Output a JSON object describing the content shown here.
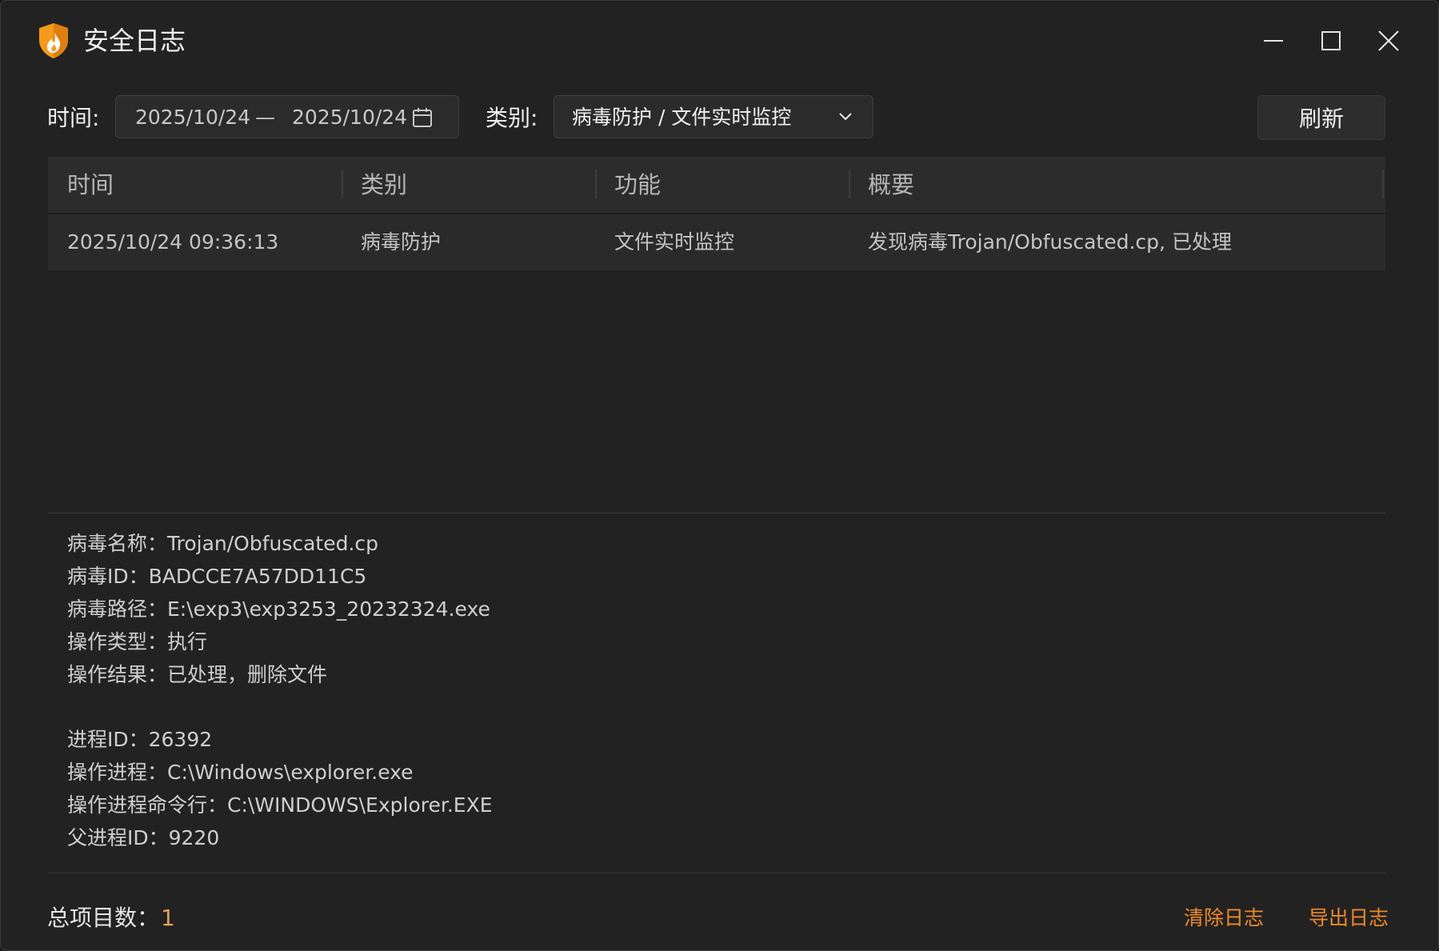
{
  "window": {
    "title": "安全日志"
  },
  "filters": {
    "time_label": "时间:",
    "date_start": "2025/10/24",
    "date_separator": "—",
    "date_end": "2025/10/24",
    "category_label": "类别:",
    "category_value": "病毒防护 / 文件实时监控",
    "refresh_label": "刷新"
  },
  "table": {
    "columns": [
      "时间",
      "类别",
      "功能",
      "概要"
    ],
    "rows": [
      [
        "2025/10/24 09:36:13",
        "病毒防护",
        "文件实时监控",
        "发现病毒Trojan/Obfuscated.cp, 已处理"
      ]
    ]
  },
  "detail": {
    "lines_a": [
      "病毒名称：Trojan/Obfuscated.cp",
      "病毒ID：BADCCE7A57DD11C5",
      "病毒路径：E:\\exp3\\exp3253_20232324.exe",
      "操作类型：执行",
      "操作结果：已处理，删除文件"
    ],
    "lines_b": [
      "进程ID：26392",
      "操作进程：C:\\Windows\\explorer.exe",
      "操作进程命令行：C:\\WINDOWS\\Explorer.EXE",
      "父进程ID：9220"
    ]
  },
  "footer": {
    "total_label": "总项目数：",
    "total_value": "1",
    "clear_label": "清除日志",
    "export_label": "导出日志"
  },
  "colors": {
    "background": "#222222",
    "accent_link": "#ef8a2a",
    "logo_orange": "#f59a1b"
  },
  "icons": [
    "app-shield-flame-icon",
    "minimize-icon",
    "maximize-icon",
    "close-icon",
    "calendar-icon",
    "chevron-down-icon"
  ]
}
